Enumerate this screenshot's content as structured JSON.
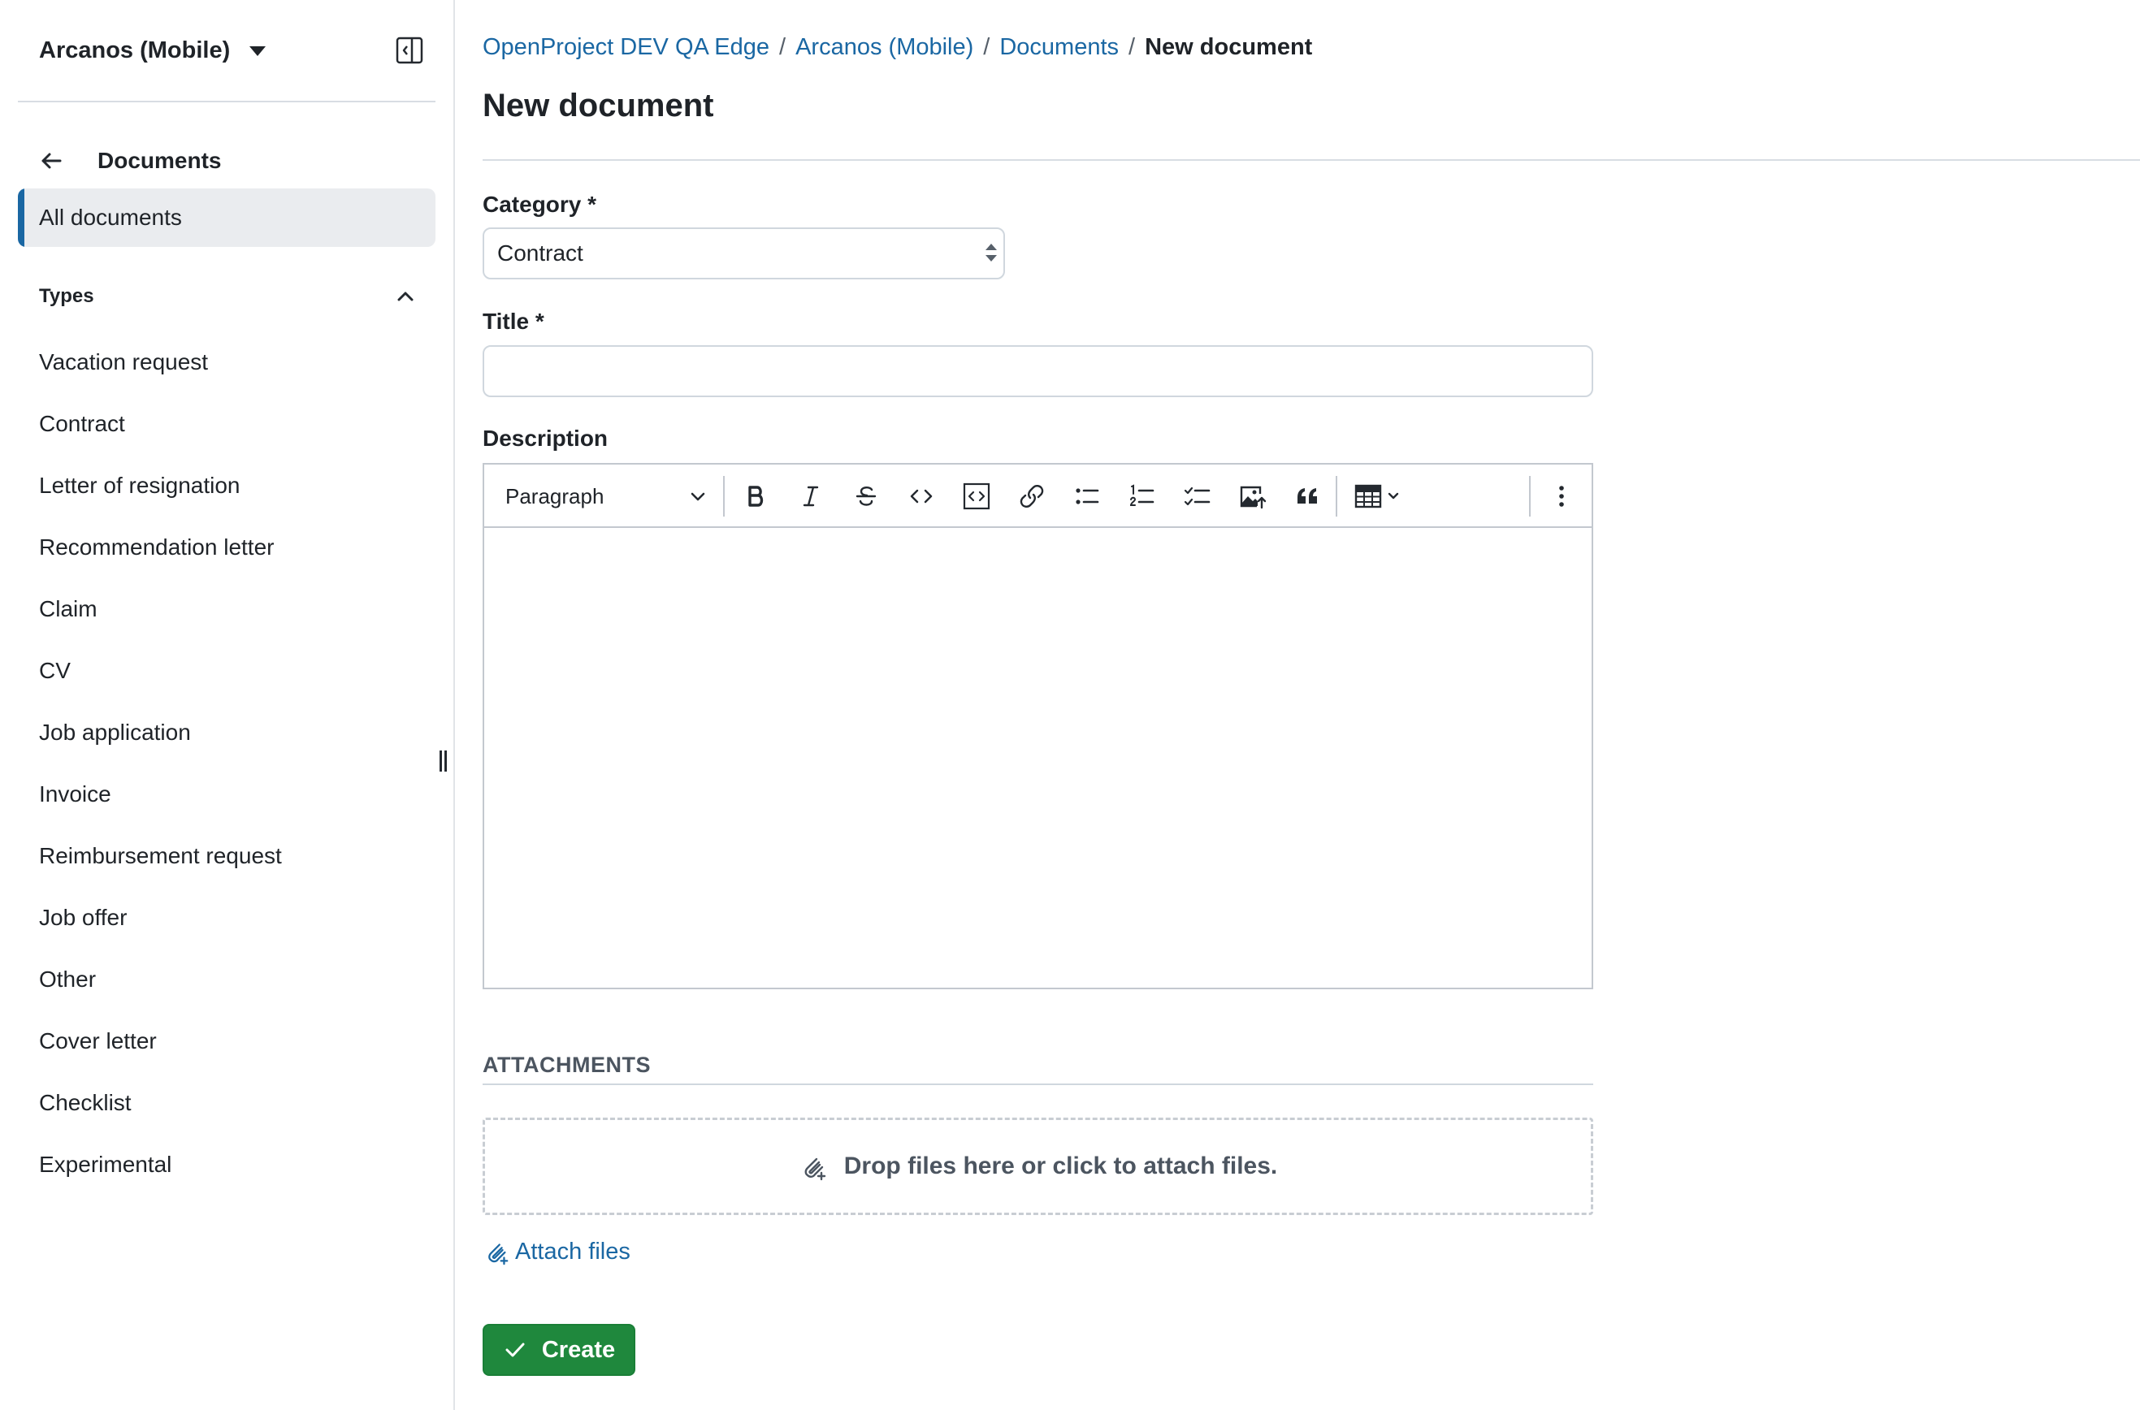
{
  "sidebar": {
    "project_name": "Arcanos (Mobile)",
    "back_title": "Documents",
    "active_item": "All documents",
    "types_label": "Types",
    "types": [
      "Vacation request",
      "Contract",
      "Letter of resignation",
      "Recommendation letter",
      "Claim",
      "CV",
      "Job application",
      "Invoice",
      "Reimbursement request",
      "Job offer",
      "Other",
      "Cover letter",
      "Checklist",
      "Experimental"
    ]
  },
  "breadcrumb": {
    "items": [
      "OpenProject DEV QA Edge",
      "Arcanos (Mobile)",
      "Documents"
    ],
    "separator": "/",
    "current": "New document"
  },
  "page": {
    "title": "New document"
  },
  "form": {
    "category_label": "Category *",
    "category_value": "Contract",
    "title_label": "Title *",
    "title_value": "",
    "description_label": "Description",
    "editor": {
      "block_format": "Paragraph",
      "tools": [
        "bold-icon",
        "italic-icon",
        "strikethrough-icon",
        "code-icon",
        "code-block-icon",
        "link-icon",
        "bulleted-list-icon",
        "numbered-list-icon",
        "todo-list-icon",
        "image-upload-icon",
        "quote-icon",
        "table-icon",
        "more-vertical-icon"
      ]
    }
  },
  "attachments": {
    "header": "ATTACHMENTS",
    "dropzone_text": "Drop files here or click to attach files.",
    "attach_link": "Attach files"
  },
  "actions": {
    "create_label": "Create"
  },
  "colors": {
    "link": "#1a67a3",
    "primary_button": "#1f883d",
    "active_indicator": "#1a67a3",
    "active_bg": "#eaecef"
  }
}
